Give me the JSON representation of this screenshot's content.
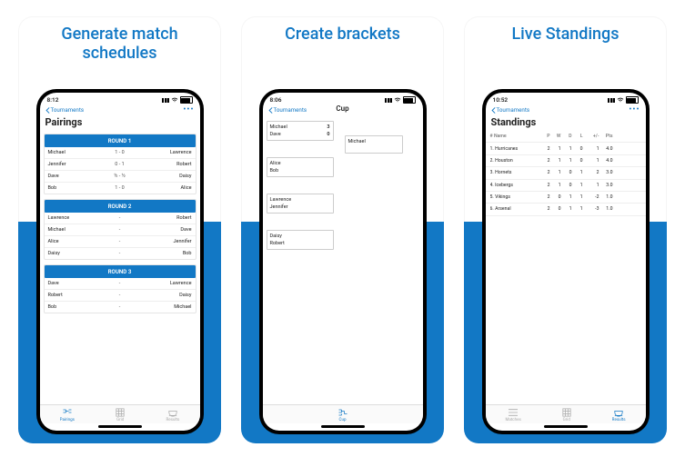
{
  "captions": {
    "a": "Generate match schedules",
    "b": "Create brackets",
    "c": "Live Standings"
  },
  "phoneA": {
    "time": "8:12",
    "back": "Tournaments",
    "title": "Pairings",
    "rounds": [
      {
        "name": "ROUND 1",
        "matches": [
          {
            "p1": "Michael",
            "score": "1 - 0",
            "p2": "Lawrence"
          },
          {
            "p1": "Jennifer",
            "score": "0 - 1",
            "p2": "Robert"
          },
          {
            "p1": "Dave",
            "score": "½ - ½",
            "p2": "Daisy"
          },
          {
            "p1": "Bob",
            "score": "1 - 0",
            "p2": "Alice"
          }
        ]
      },
      {
        "name": "ROUND 2",
        "matches": [
          {
            "p1": "Lawrence",
            "score": "-",
            "p2": "Robert"
          },
          {
            "p1": "Michael",
            "score": "-",
            "p2": "Dave"
          },
          {
            "p1": "Alice",
            "score": "-",
            "p2": "Jennifer"
          },
          {
            "p1": "Daisy",
            "score": "-",
            "p2": "Bob"
          }
        ]
      },
      {
        "name": "ROUND 3",
        "matches": [
          {
            "p1": "Dave",
            "score": "-",
            "p2": "Lawrence"
          },
          {
            "p1": "Robert",
            "score": "-",
            "p2": "Daisy"
          },
          {
            "p1": "Bob",
            "score": "-",
            "p2": "Michael"
          }
        ]
      }
    ],
    "tabs": {
      "pairings": "Pairings",
      "grid": "Grid",
      "results": "Results"
    }
  },
  "phoneB": {
    "time": "8:06",
    "back": "Tournaments",
    "title": "Cup",
    "r1": [
      {
        "p1": "Michael",
        "s1": "3",
        "p2": "Dave",
        "s2": "0"
      },
      {
        "p1": "Alice",
        "s1": "",
        "p2": "Bob",
        "s2": ""
      },
      {
        "p1": "Lawrence",
        "s1": "",
        "p2": "Jennifer",
        "s2": ""
      },
      {
        "p1": "Daisy",
        "s1": "",
        "p2": "Robert",
        "s2": ""
      }
    ],
    "r2": [
      {
        "p1": "Michael"
      }
    ],
    "tabs": {
      "cup": "Cup"
    }
  },
  "phoneC": {
    "time": "10:52",
    "back": "Tournaments",
    "title": "Standings",
    "headers": {
      "num": "#",
      "name": "Name",
      "p": "P",
      "w": "W",
      "d": "D",
      "l": "L",
      "pm": "+/-",
      "pts": "Pts"
    },
    "rows": [
      {
        "num": "1.",
        "name": "Hurricanes",
        "p": "2",
        "w": "1",
        "d": "1",
        "l": "0",
        "pm": "1",
        "pts": "4.0"
      },
      {
        "num": "2.",
        "name": "Houston",
        "p": "2",
        "w": "1",
        "d": "1",
        "l": "0",
        "pm": "1",
        "pts": "4.0"
      },
      {
        "num": "3.",
        "name": "Hornets",
        "p": "2",
        "w": "1",
        "d": "0",
        "l": "1",
        "pm": "2",
        "pts": "3.0"
      },
      {
        "num": "4.",
        "name": "Icebergs",
        "p": "2",
        "w": "1",
        "d": "0",
        "l": "1",
        "pm": "1",
        "pts": "3.0"
      },
      {
        "num": "5.",
        "name": "Vikings",
        "p": "2",
        "w": "0",
        "d": "1",
        "l": "1",
        "pm": "-2",
        "pts": "1.0"
      },
      {
        "num": "6.",
        "name": "Arsenal",
        "p": "2",
        "w": "0",
        "d": "1",
        "l": "1",
        "pm": "-3",
        "pts": "1.0"
      }
    ],
    "tabs": {
      "matches": "Matches",
      "grid": "Grid",
      "results": "Results"
    }
  }
}
